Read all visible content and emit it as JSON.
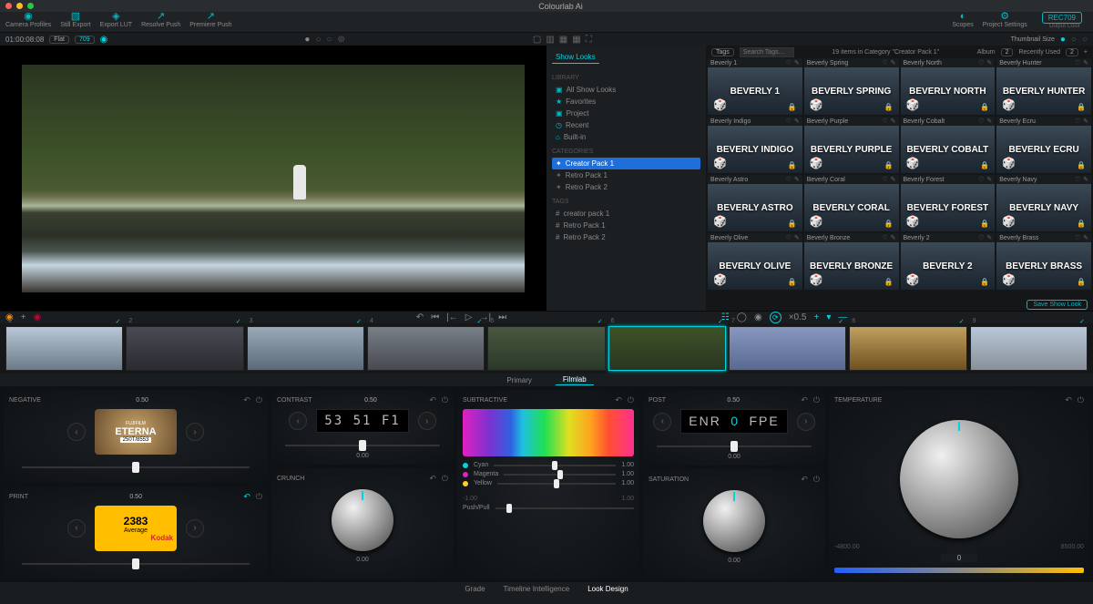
{
  "window": {
    "title": "Colourlab Ai"
  },
  "topbar": {
    "left": [
      "Camera Profiles",
      "Still Export",
      "Export LUT",
      "Resolve Push",
      "Premiere Push"
    ],
    "right": [
      "Scopes",
      "Project Settings"
    ],
    "rec": "REC709",
    "output": "Output Color"
  },
  "viewbar": {
    "timecode": "01:00:08:08",
    "pills": [
      "Flat",
      "709"
    ],
    "thumbnail": "Thumbnail Size"
  },
  "looks": {
    "tab": "Show Looks",
    "library_h": "LIBRARY",
    "library": [
      "All Show Looks",
      "Favorites",
      "Project",
      "Recent",
      "Built-in"
    ],
    "categories_h": "CATEGORIES",
    "categories": [
      "Creator Pack 1",
      "Retro Pack 1",
      "Retro Pack 2"
    ],
    "tags_h": "TAGS",
    "tags": [
      "creator pack 1",
      "Retro Pack 1",
      "Retro Pack 2"
    ]
  },
  "gallery": {
    "heading": "19 items in Category \"Creator Pack 1\"",
    "tags_label": "Tags",
    "search_ph": "Search Tags…",
    "album": "Album",
    "album_n": "2",
    "recent": "Recently Used",
    "recent_n": "2",
    "save_btn": "Save Show Look",
    "rows": [
      [
        {
          "lbl": "Beverly 1",
          "name": "BEVERLY 1"
        },
        {
          "lbl": "Beverly Spring",
          "name": "BEVERLY SPRING"
        },
        {
          "lbl": "Beverly North",
          "name": "BEVERLY NORTH"
        },
        {
          "lbl": "Beverly Hunter",
          "name": "BEVERLY HUNTER"
        }
      ],
      [
        {
          "lbl": "Beverly Indigo",
          "name": "BEVERLY INDIGO"
        },
        {
          "lbl": "Beverly Purple",
          "name": "BEVERLY PURPLE"
        },
        {
          "lbl": "Beverly Cobalt",
          "name": "BEVERLY COBALT"
        },
        {
          "lbl": "Beverly Ecru",
          "name": "BEVERLY ECRU"
        }
      ],
      [
        {
          "lbl": "Beverly Astro",
          "name": "BEVERLY ASTRO"
        },
        {
          "lbl": "Beverly Coral",
          "name": "BEVERLY CORAL"
        },
        {
          "lbl": "Beverly Forest",
          "name": "BEVERLY FOREST"
        },
        {
          "lbl": "Beverly Navy",
          "name": "BEVERLY NAVY"
        }
      ],
      [
        {
          "lbl": "Beverly Olive",
          "name": "BEVERLY OLIVE"
        },
        {
          "lbl": "Beverly Bronze",
          "name": "BEVERLY BRONZE"
        },
        {
          "lbl": "Beverly 2",
          "name": "BEVERLY 2"
        },
        {
          "lbl": "Beverly Brass",
          "name": "BEVERLY BRASS"
        }
      ]
    ]
  },
  "transport": {
    "scale": "×0.5"
  },
  "timeline": {
    "count": 9,
    "active": 6
  },
  "grade_tabs": [
    "Primary",
    "Filmlab"
  ],
  "controls": {
    "negative": {
      "label": "NEGATIVE",
      "val": "0.50",
      "stock_top": "FUJIFILM",
      "stock": "ETERNA",
      "code": "250T/8553"
    },
    "print": {
      "label": "PRINT",
      "val": "0.50",
      "num": "2383",
      "avg": "Average",
      "brand": "Kodak"
    },
    "contrast": {
      "label": "CONTRAST",
      "val": "0.50",
      "digits": "53 51 F1",
      "scale": "0.00"
    },
    "crunch": {
      "label": "CRUNCH",
      "scale": "0.00"
    },
    "subtractive": {
      "label": "SUBTRACTIVE",
      "cyan": "Cyan",
      "magenta": "Magenta",
      "yellow": "Yellow",
      "pp": "Push/Pull",
      "v": "1.00",
      "neg": "-1.00"
    },
    "post": {
      "label": "POST",
      "val": "0.50",
      "digits_l": "ENR",
      "digits_c": "0",
      "digits_r": "FPE",
      "scale": "0.00"
    },
    "saturation": {
      "label": "SATURATION",
      "scale": "0.00"
    },
    "temperature": {
      "label": "TEMPERATURE",
      "min": "-4800.00",
      "max": "8500.00",
      "val": "0"
    }
  },
  "footer": [
    "Grade",
    "Timeline Intelligence",
    "Look Design"
  ]
}
